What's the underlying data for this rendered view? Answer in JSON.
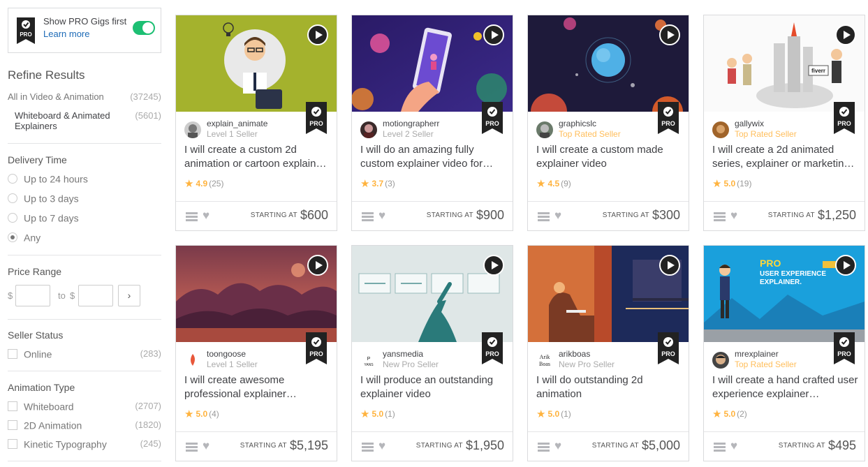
{
  "pro_toggle": {
    "label": "Show PRO Gigs first",
    "link": "Learn more",
    "badge": "PRO",
    "enabled": true
  },
  "refine": {
    "title": "Refine Results",
    "all_label": "All in Video & Animation",
    "all_count": "(37245)",
    "sub_label": "Whiteboard & Animated Explainers",
    "sub_count": "(5601)"
  },
  "delivery": {
    "title": "Delivery Time",
    "options": [
      "Up to 24 hours",
      "Up to 3 days",
      "Up to 7 days",
      "Any"
    ],
    "selected": "Any"
  },
  "price_range": {
    "title": "Price Range",
    "currency": "$",
    "to": "to",
    "go": "›"
  },
  "seller_status": {
    "title": "Seller Status",
    "options": [
      {
        "label": "Online",
        "count": "(283)"
      }
    ]
  },
  "animation_type": {
    "title": "Animation Type",
    "options": [
      {
        "label": "Whiteboard",
        "count": "(2707)"
      },
      {
        "label": "2D Animation",
        "count": "(1820)"
      },
      {
        "label": "Kinetic Typography",
        "count": "(245)"
      }
    ]
  },
  "starting_at": "STARTING AT",
  "pro_label": "PRO",
  "gigs": [
    {
      "seller": "explain_animate",
      "level": "Level 1 Seller",
      "title": "I will create a custom 2d animation or cartoon explain…",
      "rating": "4.9",
      "reviews": "(25)",
      "price": "$600"
    },
    {
      "seller": "motiongrapherr",
      "level": "Level 2 Seller",
      "title": "I will do an amazing fully custom explainer video for…",
      "rating": "3.7",
      "reviews": "(3)",
      "price": "$900"
    },
    {
      "seller": "graphicslc",
      "level": "Top Rated Seller",
      "title": "I will create a custom made explainer video",
      "rating": "4.5",
      "reviews": "(9)",
      "price": "$300"
    },
    {
      "seller": "gallywix",
      "level": "Top Rated Seller",
      "title": "I will create a 2d animated series, explainer or marketin…",
      "rating": "5.0",
      "reviews": "(19)",
      "price": "$1,250"
    },
    {
      "seller": "toongoose",
      "level": "Level 1 Seller",
      "title": "I will create awesome professional explainer…",
      "rating": "5.0",
      "reviews": "(4)",
      "price": "$5,195"
    },
    {
      "seller": "yansmedia",
      "level": "New Pro Seller",
      "title": "I will produce an outstanding explainer video",
      "rating": "5.0",
      "reviews": "(1)",
      "price": "$1,950"
    },
    {
      "seller": "arikboas",
      "level": "New Pro Seller",
      "title": "I will do outstanding 2d animation",
      "rating": "5.0",
      "reviews": "(1)",
      "price": "$5,000"
    },
    {
      "seller": "mrexplainer",
      "level": "Top Rated Seller",
      "title": "I will create a hand crafted user experience explainer…",
      "rating": "5.0",
      "reviews": "(2)",
      "price": "$495"
    }
  ],
  "thumb_texts": {
    "fiverr_sign": "fiverr",
    "yans_logo": "YANS",
    "arik_logo_1": "Arik",
    "arik_logo_2": "Boas",
    "ux_pro": "PRO",
    "ux_line1": "USER EXPERIENCE",
    "ux_line2": "EXPLAINER."
  }
}
